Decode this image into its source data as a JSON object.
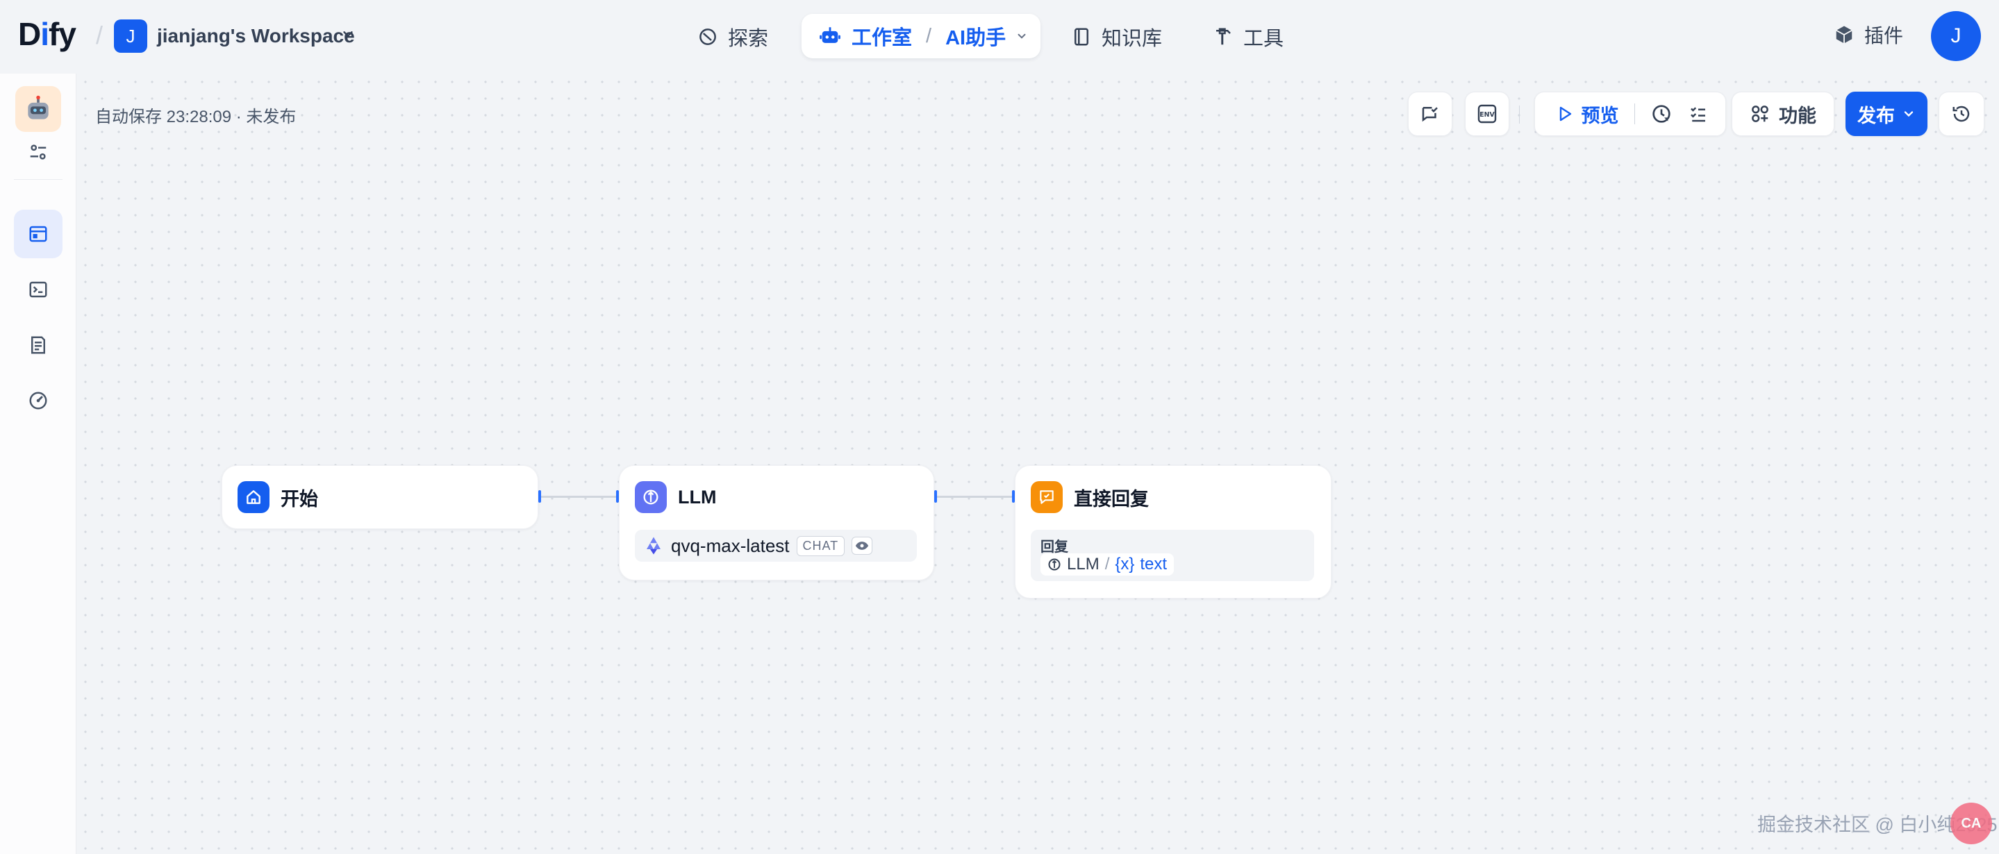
{
  "header": {
    "logo_prefix": "D",
    "logo_i": "i",
    "logo_suffix": "fy",
    "workspace_initial": "J",
    "workspace_name": "jianjang's Workspace",
    "nav": {
      "explore": "探索",
      "studio": "工作室",
      "app_name": "AI助手",
      "knowledge": "知识库",
      "tools": "工具"
    },
    "plugins": "插件",
    "avatar_initial": "J"
  },
  "canvas": {
    "autosave_status": "自动保存 23:28:09 · 未发布",
    "toolbar": {
      "preview": "预览",
      "features": "功能",
      "publish": "发布"
    }
  },
  "nodes": {
    "start": {
      "title": "开始"
    },
    "llm": {
      "title": "LLM",
      "model": "qvq-max-latest",
      "mode_tag": "CHAT"
    },
    "answer": {
      "title": "直接回复",
      "label": "回复",
      "source_node": "LLM",
      "separator": "/",
      "variable_prefix": "{x}",
      "variable": "text"
    }
  },
  "watermark": "掘金技术社区 @ 白小纯2025",
  "watermark_badge": "CA",
  "colors": {
    "primary": "#155eef",
    "start_node": "#155eef",
    "llm_node": "#6172f3",
    "answer_node": "#f79009",
    "app_icon_bg": "#ffead5"
  },
  "icons": [
    "explore-icon",
    "robot-icon",
    "book-icon",
    "hammer-icon",
    "cube-icon",
    "sliders-icon",
    "app-panel-icon",
    "terminal-icon",
    "log-icon",
    "gauge-icon",
    "chat-check-icon",
    "env-icon",
    "play-icon",
    "history-run-icon",
    "checklist-icon",
    "features-icon",
    "chevron-down-icon",
    "clock-history-icon",
    "home-icon",
    "llm-icon",
    "reply-icon",
    "qwen-icon",
    "eye-icon"
  ]
}
